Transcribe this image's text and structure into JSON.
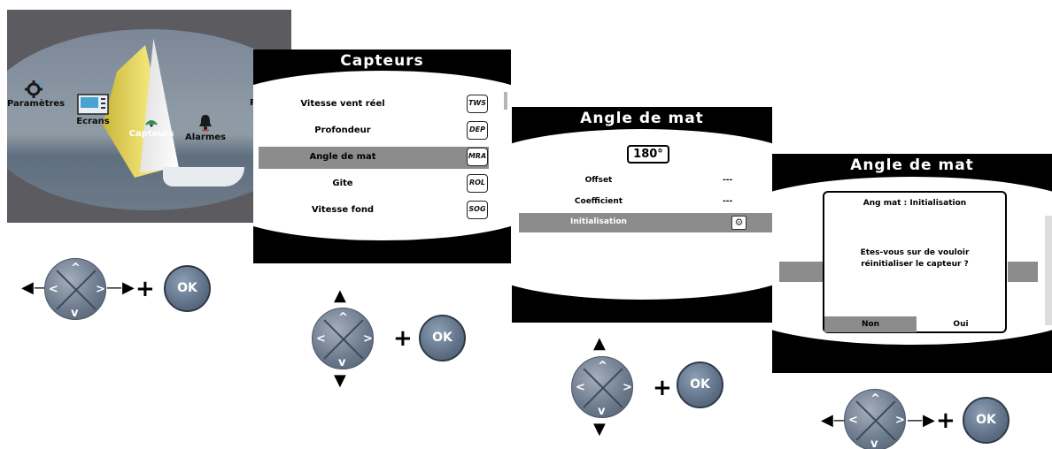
{
  "screen1": {
    "menu": [
      {
        "label": "Paramètres",
        "icon": "gear-icon"
      },
      {
        "label": "Ecrans",
        "icon": "screen-icon"
      },
      {
        "label": "Capteurs",
        "icon": "sensor-icon"
      },
      {
        "label": "Alarmes",
        "icon": "bell-icon"
      }
    ],
    "edge_char": "P"
  },
  "screen2": {
    "title": "Capteurs",
    "rows": [
      {
        "label": "Vitesse vent réel",
        "badge": "TWS"
      },
      {
        "label": "Profondeur",
        "badge": "DEP"
      },
      {
        "label": "Angle de mat",
        "badge": "MRA"
      },
      {
        "label": "Gite",
        "badge": "ROL"
      },
      {
        "label": "Vitesse fond",
        "badge": "SOG"
      }
    ],
    "selected_index": 2
  },
  "screen3": {
    "title": "Angle de mat",
    "angle": "180°",
    "rows": [
      {
        "label": "Offset",
        "value": "---"
      },
      {
        "label": "Coefficient",
        "value": "---"
      },
      {
        "label": "Initialisation",
        "value": ""
      }
    ]
  },
  "screen4": {
    "title": "Angle de mat",
    "dialog_title": "Ang mat : Initialisation",
    "dialog_message_line1": "Etes-vous sur de vouloir",
    "dialog_message_line2": "réinitialiser le capteur ?",
    "btn_no": "Non",
    "btn_yes": "Oui"
  },
  "controls": {
    "ok_label": "OK",
    "plus": "+"
  }
}
